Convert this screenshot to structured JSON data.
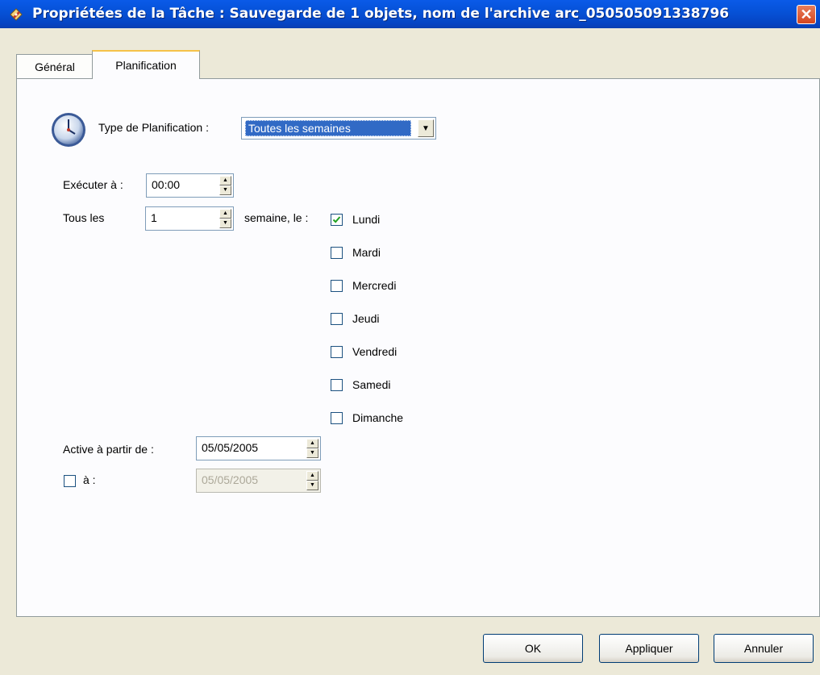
{
  "window": {
    "title": "Propriétées de la Tâche : Sauvegarde de 1 objets, nom de l'archive arc_050505091338796",
    "close_glyph": "✕"
  },
  "tabs": [
    {
      "label": "Général",
      "active": false
    },
    {
      "label": "Planification",
      "active": true
    }
  ],
  "schedule": {
    "type_label": "Type de Planification :",
    "type_value": "Toutes les semaines",
    "run_at_label": "Exécuter à :",
    "run_at_value": "00:00",
    "every_label": "Tous les",
    "every_value": "1",
    "week_label": "semaine, le :",
    "days": [
      {
        "label": "Lundi",
        "checked": true
      },
      {
        "label": "Mardi",
        "checked": false
      },
      {
        "label": "Mercredi",
        "checked": false
      },
      {
        "label": "Jeudi",
        "checked": false
      },
      {
        "label": "Vendredi",
        "checked": false
      },
      {
        "label": "Samedi",
        "checked": false
      },
      {
        "label": "Dimanche",
        "checked": false
      }
    ],
    "active_from_label": "Active à partir de :",
    "active_from_value": "05/05/2005",
    "until_label": "à :",
    "until_checked": false,
    "until_value": "05/05/2005"
  },
  "buttons": {
    "ok": "OK",
    "apply": "Appliquer",
    "cancel": "Annuler"
  },
  "icons": {
    "app": "tag-pencil-icon",
    "clock": "clock-icon",
    "dropdown": "chevron-down-icon",
    "spin_up": "spin-up-icon",
    "spin_down": "spin-down-icon",
    "check": "checkmark-icon"
  },
  "colors": {
    "titlebar": "#0652d8",
    "selection": "#316ac5",
    "close": "#d5461f",
    "tab_highlight": "#f6c249"
  }
}
